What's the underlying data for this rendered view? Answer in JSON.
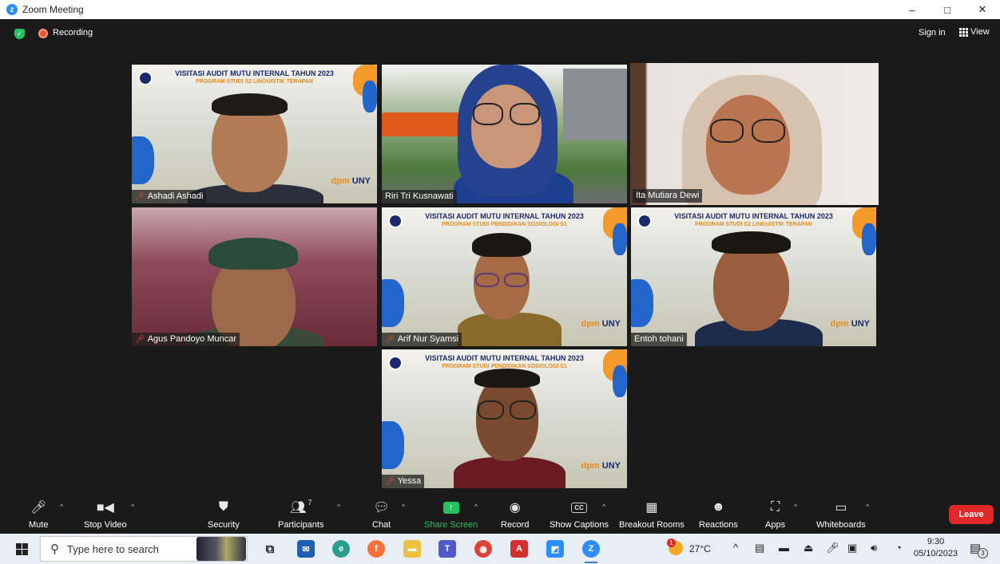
{
  "window": {
    "title": "Zoom Meeting",
    "controls": {
      "minimize": "–",
      "maximize": "□",
      "close": "✕"
    }
  },
  "topbar": {
    "recording_label": "Recording",
    "sign_in_label": "Sign in",
    "view_label": "View"
  },
  "participants": [
    {
      "name": "Ashadi Ashadi",
      "muted": true,
      "background": "slide",
      "slide_title": "VISITASI AUDIT MUTU INTERNAL TAHUN 2023",
      "slide_subtitle": "PROGRAM STUDI S2 LINGUISTIK TERAPAN"
    },
    {
      "name": "Riri Tri Kusnawati",
      "muted": false,
      "background": "outdoor"
    },
    {
      "name": "Ita Mutiara Dewi",
      "muted": false,
      "background": "wall",
      "active_speaker": true
    },
    {
      "name": "Agus Pandoyo Muncar",
      "muted": true,
      "background": "blurred"
    },
    {
      "name": "Arif Nur Syamsi",
      "muted": true,
      "background": "slide",
      "slide_title": "VISITASI AUDIT MUTU INTERNAL TAHUN 2023",
      "slide_subtitle": "PROGRAM STUDI PENDIDIKAN SOSIOLOGI S1"
    },
    {
      "name": "Entoh tohani",
      "muted": false,
      "background": "slide",
      "slide_title": "VISITASI AUDIT MUTU INTERNAL TAHUN 2023",
      "slide_subtitle": "PROGRAM STUDI S2 LINGUISTIK TERAPAN"
    },
    {
      "name": "Yessa",
      "muted": true,
      "background": "slide",
      "slide_title": "VISITASI AUDIT MUTU INTERNAL TAHUN 2023",
      "slide_subtitle": "PROGRAM STUDI PENDIDIKAN SOSIOLOGI S1"
    }
  ],
  "slide_brand": {
    "dpm": "dpm",
    "uny": "UNY"
  },
  "toolbar": {
    "mute": "Mute",
    "stop_video": "Stop Video",
    "security": "Security",
    "participants": "Participants",
    "participants_count": "7",
    "chat": "Chat",
    "share_screen": "Share Screen",
    "record": "Record",
    "show_captions": "Show Captions",
    "cc_icon_text": "CC",
    "breakout_rooms": "Breakout Rooms",
    "reactions": "Reactions",
    "apps": "Apps",
    "whiteboards": "Whiteboards",
    "leave": "Leave"
  },
  "taskbar": {
    "search_placeholder": "Type here to search",
    "weather_temp": "27°C",
    "weather_badge": "1",
    "time": "9:30",
    "date": "05/10/2023",
    "notification_count": "3"
  },
  "colors": {
    "share_green": "#23c45e",
    "leave_red": "#e02828",
    "active_speaker_border": "#c8e36b",
    "zoom_blue": "#2d8cff"
  }
}
